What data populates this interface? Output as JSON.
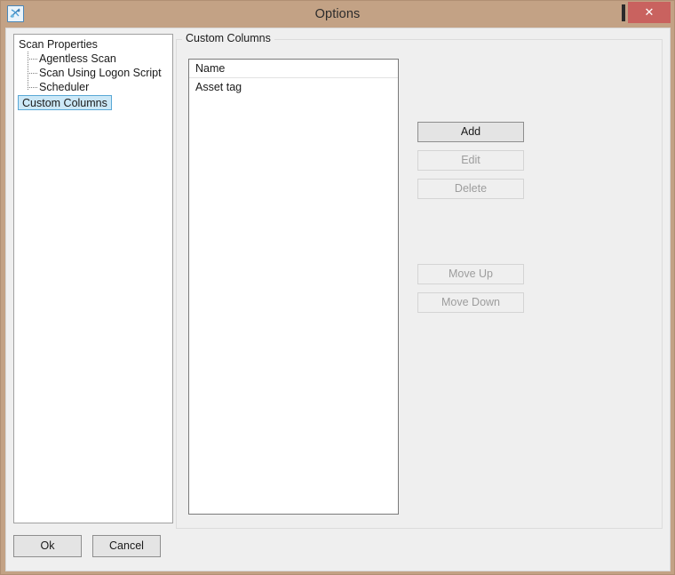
{
  "window": {
    "title": "Options",
    "icon": "scan-app-icon",
    "frame_color": "#c3a285",
    "client_bg": "#efefef",
    "controls": {
      "minimize": "minimize-icon",
      "maximize": "maximize-icon",
      "close": "close-icon",
      "close_color": "#c9625f"
    }
  },
  "tree": {
    "root": {
      "label": "Scan Properties"
    },
    "children": [
      {
        "label": "Agentless Scan"
      },
      {
        "label": "Scan Using Logon Script"
      },
      {
        "label": "Scheduler"
      }
    ],
    "selected": {
      "label": "Custom Columns",
      "highlight": "#cce8f7",
      "border": "#5aa8d6"
    }
  },
  "groupbox": {
    "label": "Custom Columns"
  },
  "listview": {
    "columns": [
      "Name"
    ],
    "rows": [
      {
        "name": "Asset tag"
      }
    ]
  },
  "actions": [
    {
      "id": "add",
      "label": "Add",
      "enabled": true
    },
    {
      "id": "edit",
      "label": "Edit",
      "enabled": false
    },
    {
      "id": "delete",
      "label": "Delete",
      "enabled": false
    },
    {
      "id": "moveup",
      "label": "Move Up",
      "enabled": false
    },
    {
      "id": "movedown",
      "label": "Move Down",
      "enabled": false
    }
  ],
  "dialog_buttons": {
    "ok": "Ok",
    "cancel": "Cancel"
  }
}
